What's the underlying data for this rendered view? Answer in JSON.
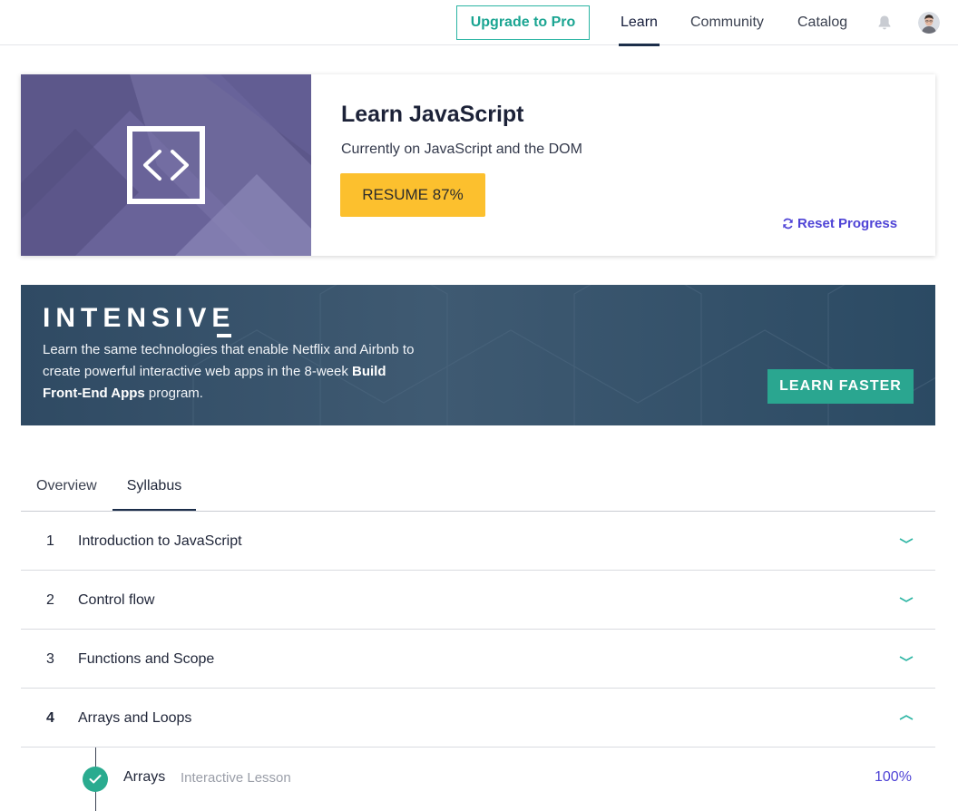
{
  "nav": {
    "upgrade_label": "Upgrade to Pro",
    "links": [
      "Learn",
      "Community",
      "Catalog"
    ],
    "active_link": "Learn",
    "bell_icon": "bell-icon",
    "avatar_icon": "user-avatar"
  },
  "course": {
    "art_icon": "code-brackets-icon",
    "title": "Learn JavaScript",
    "current": "Currently on JavaScript and the DOM",
    "resume_label": "RESUME 87%",
    "progress_percent": 87,
    "reset_label": "Reset Progress",
    "reset_icon": "refresh-icon"
  },
  "banner": {
    "title": "INTENSIVE",
    "text_before": "Learn the same technologies that enable Netflix and Airbnb to create powerful interactive web apps in the 8-week ",
    "text_bold": "Build Front-End Apps",
    "text_after": " program.",
    "cta_label": "LEARN FASTER"
  },
  "tabs": {
    "overview": "Overview",
    "syllabus": "Syllabus",
    "active": "Syllabus"
  },
  "syllabus": {
    "units": [
      {
        "number": "1",
        "title": "Introduction to JavaScript",
        "expanded": false
      },
      {
        "number": "2",
        "title": "Control flow",
        "expanded": false
      },
      {
        "number": "3",
        "title": "Functions and Scope",
        "expanded": false
      },
      {
        "number": "4",
        "title": "Arrays and Loops",
        "expanded": true
      }
    ],
    "lessons": [
      {
        "title": "Arrays",
        "type": "Interactive Lesson",
        "progress": "100%",
        "completed": true
      }
    ]
  },
  "colors": {
    "teal": "#2bb5a3",
    "purple_link": "#4f44d6",
    "resume_yellow": "#fcc02e",
    "banner_bg": "#34506a",
    "cta_green": "#2aa690"
  }
}
